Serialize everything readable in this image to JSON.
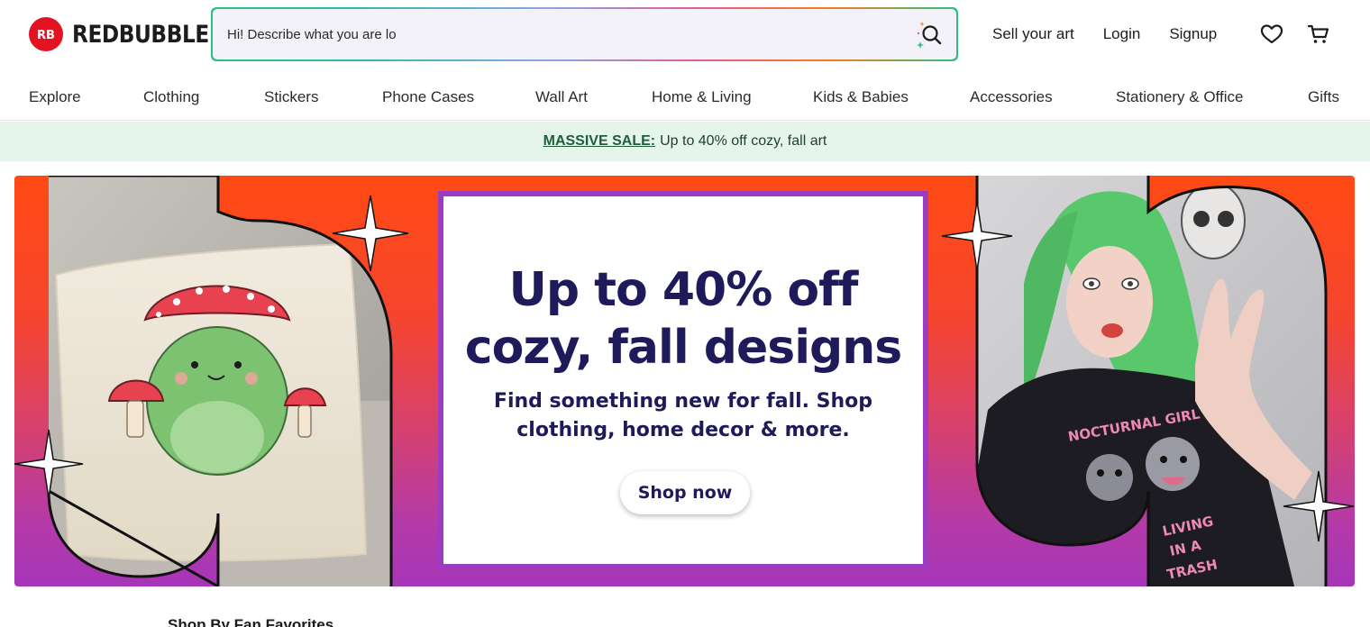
{
  "brand": {
    "name": "REDBUBBLE",
    "mark": "RB",
    "color": "#e41321"
  },
  "search": {
    "placeholder": "Hi! Describe what you are lo",
    "icon": "sparkle-search-icon"
  },
  "header_links": {
    "sell": "Sell your art",
    "login": "Login",
    "signup": "Signup"
  },
  "header_icons": {
    "wishlist": "heart-icon",
    "cart": "cart-icon"
  },
  "nav": {
    "items": [
      "Explore",
      "Clothing",
      "Stickers",
      "Phone Cases",
      "Wall Art",
      "Home & Living",
      "Kids & Babies",
      "Accessories",
      "Stationery & Office",
      "Gifts"
    ]
  },
  "promo": {
    "link": "MASSIVE SALE:",
    "text": "Up to 40% off cozy, fall art",
    "bg": "#e6f5ec"
  },
  "hero": {
    "title_line1": "Up to 40% off",
    "title_line2": "cozy, fall designs",
    "subtitle_line1": "Find something new for fall. Shop",
    "subtitle_line2": "clothing, home decor & more.",
    "cta": "Shop now",
    "left_image": "frog-mushroom-pillow",
    "right_image": "green-hair-model-tshirt",
    "shirt_text": [
      "NOCTURNAL GIRL",
      "LIVING",
      "IN A",
      "TRASH"
    ]
  },
  "below": {
    "peek_text": "Shop By Fan Favorites"
  }
}
